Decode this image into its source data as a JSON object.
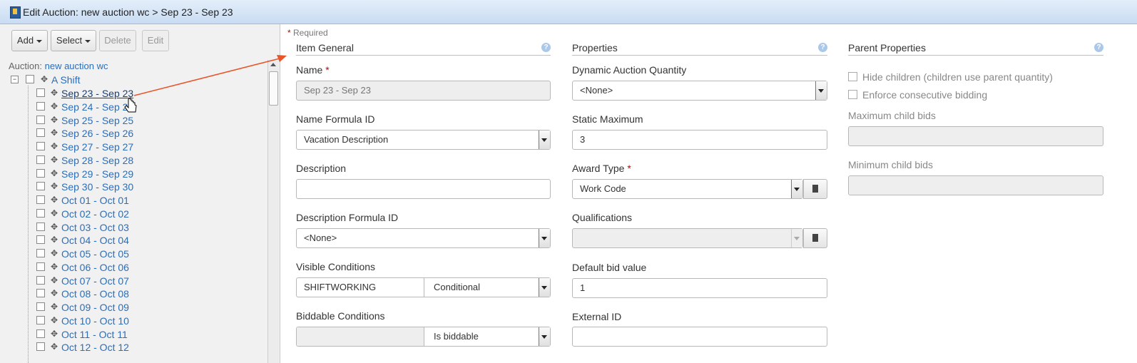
{
  "title": "Edit Auction: new auction wc > Sep 23 - Sep 23",
  "toolbar": {
    "add": "Add",
    "select": "Select",
    "delete": "Delete",
    "edit": "Edit"
  },
  "auction": {
    "label": "Auction:",
    "name": "new auction wc"
  },
  "tree": {
    "root": "A Shift",
    "items": [
      "Sep 23 - Sep 23",
      "Sep 24 - Sep 24",
      "Sep 25 - Sep 25",
      "Sep 26 - Sep 26",
      "Sep 27 - Sep 27",
      "Sep 28 - Sep 28",
      "Sep 29 - Sep 29",
      "Sep 30 - Sep 30",
      "Oct 01 - Oct 01",
      "Oct 02 - Oct 02",
      "Oct 03 - Oct 03",
      "Oct 04 - Oct 04",
      "Oct 05 - Oct 05",
      "Oct 06 - Oct 06",
      "Oct 07 - Oct 07",
      "Oct 08 - Oct 08",
      "Oct 09 - Oct 09",
      "Oct 10 - Oct 10",
      "Oct 11 - Oct 11",
      "Oct 12 - Oct 12"
    ],
    "selected_index": 0
  },
  "required_note": "Required",
  "sections": {
    "general": "Item General",
    "properties": "Properties",
    "parent": "Parent Properties"
  },
  "general": {
    "name_label": "Name",
    "name_value": "Sep 23 - Sep 23",
    "formula_label": "Name Formula ID",
    "formula_value": "Vacation Description",
    "desc_label": "Description",
    "desc_value": "",
    "desc_formula_label": "Description Formula ID",
    "desc_formula_value": "<None>",
    "visible_label": "Visible Conditions",
    "visible_value": "SHIFTWORKING",
    "visible_select": "Conditional",
    "biddable_label": "Biddable Conditions",
    "biddable_value": "",
    "biddable_select": "Is biddable"
  },
  "properties": {
    "dyn_label": "Dynamic Auction Quantity",
    "dyn_value": "<None>",
    "static_label": "Static Maximum",
    "static_value": "3",
    "award_label": "Award Type",
    "award_value": "Work Code",
    "qual_label": "Qualifications",
    "qual_value": "",
    "default_label": "Default bid value",
    "default_value": "1",
    "ext_label": "External ID",
    "ext_value": ""
  },
  "parent": {
    "hide_children": "Hide children (children use parent quantity)",
    "enforce": "Enforce consecutive bidding",
    "max_label": "Maximum child bids",
    "min_label": "Minimum child bids"
  },
  "colors": {
    "link": "#2a6ebb",
    "required": "#cc0000",
    "annotation_arrow": "#e8552a"
  }
}
